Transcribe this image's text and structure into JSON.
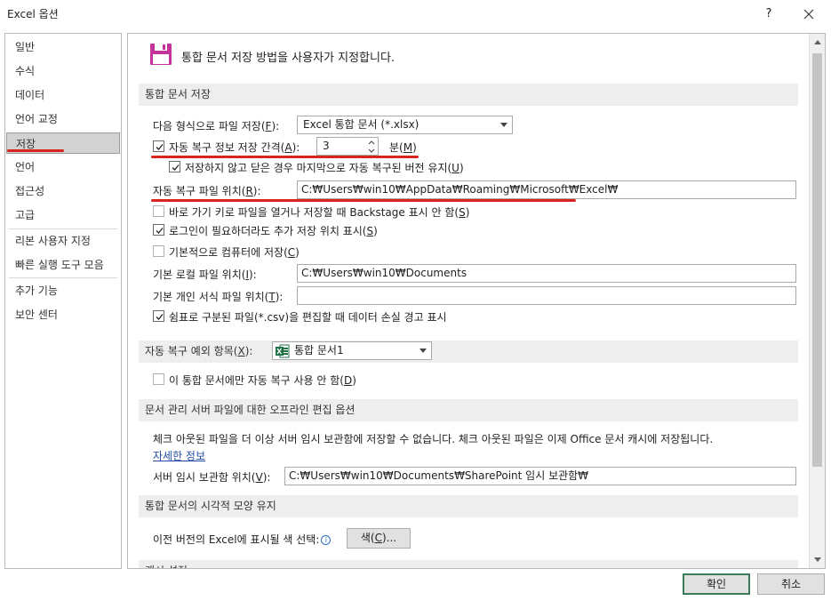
{
  "window": {
    "title": "Excel 옵션",
    "help": "?"
  },
  "sidebar": {
    "items": [
      {
        "label": "일반"
      },
      {
        "label": "수식"
      },
      {
        "label": "데이터"
      },
      {
        "label": "언어 교정"
      },
      {
        "label": "저장",
        "selected": true
      },
      {
        "label": "언어"
      },
      {
        "label": "접근성"
      },
      {
        "label": "고급"
      },
      {
        "label": "리본 사용자 지정"
      },
      {
        "label": "빠른 실행 도구 모음"
      },
      {
        "label": "추가 기능"
      },
      {
        "label": "보안 센터"
      }
    ]
  },
  "header": {
    "text": "통합 문서 저장 방법을 사용자가 지정합니다."
  },
  "save_section": {
    "title": "통합 문서 저장",
    "format_label": "다음 형식으로 파일 저장(",
    "format_key": "F",
    "format_suffix": "):",
    "format_value": "Excel 통합 문서 (*.xlsx)",
    "autorecover_label": "자동 복구 정보 저장 간격(",
    "autorecover_key": "A",
    "autorecover_suffix": "):",
    "autorecover_checked": true,
    "interval_value": "3",
    "minutes_label": "분(",
    "minutes_key": "M",
    "minutes_suffix": ")",
    "keep_version_label": "저장하지 않고 닫은 경우 마지막으로 자동 복구된 버전 유지(",
    "keep_version_key": "U",
    "keep_version_suffix": ")",
    "keep_version_checked": true,
    "autorecover_location_label": "자동 복구 파일 위치(",
    "autorecover_location_key": "R",
    "autorecover_location_suffix": "):",
    "autorecover_location_value": "C:₩Users₩win10₩AppData₩Roaming₩Microsoft₩Excel₩",
    "no_backstage_label": "바로 가기 키로 파일을 열거나 저장할 때 Backstage 표시 안 함(",
    "no_backstage_key": "S",
    "no_backstage_suffix": ")",
    "no_backstage_checked": false,
    "show_locations_label": "로그인이 필요하더라도 추가 저장 위치 표시(",
    "show_locations_key": "S",
    "show_locations_suffix": ")",
    "show_locations_checked": true,
    "save_computer_label": "기본적으로 컴퓨터에 저장(",
    "save_computer_key": "C",
    "save_computer_suffix": ")",
    "save_computer_checked": false,
    "local_location_label": "기본 로컬 파일 위치(",
    "local_location_key": "I",
    "local_location_suffix": "):",
    "local_location_value": "C:₩Users₩win10₩Documents",
    "personal_templates_label": "기본 개인 서식 파일 위치(",
    "personal_templates_key": "T",
    "personal_templates_suffix": "):",
    "personal_templates_value": "",
    "csv_warning_label": "쉼표로 구분된 파일(*.csv)을 편집할 때 데이터 손실 경고 표시",
    "csv_warning_checked": true
  },
  "autorecover_exceptions": {
    "label": "자동 복구 예외 항목(",
    "key": "X",
    "suffix": "):",
    "workbook_value": "통합 문서1",
    "disable_label": "이 통합 문서에만 자동 복구 사용 안 함(",
    "disable_key": "D",
    "disable_suffix": ")",
    "disable_checked": false
  },
  "offline_editing": {
    "title": "문서 관리 서버 파일에 대한 오프라인 편집 옵션",
    "description": "체크 아웃된 파일을 더 이상 서버 임시 보관함에 저장할 수 없습니다. 체크 아웃된 파일은 이제 Office 문서 캐시에 저장됩니다.",
    "details_link": "자세한 정보",
    "drafts_label": "서버 임시 보관함 위치(",
    "drafts_key": "V",
    "drafts_suffix": "):",
    "drafts_value": "C:₩Users₩win10₩Documents₩SharePoint 임시 보관함₩"
  },
  "visual_appearance": {
    "title": "통합 문서의 시각적 모양 유지",
    "colors_label": "이전 버전의 Excel에 표시될 색 선택:",
    "colors_button_label": "색(",
    "colors_button_key": "C",
    "colors_button_suffix": ")..."
  },
  "cut_section": {
    "title": "캐시 설정"
  },
  "footer": {
    "ok": "확인",
    "cancel": "취소"
  },
  "colors": {
    "annotation_red": "#d9231f",
    "excel_green": "#1e7145",
    "save_icon": "#c2349b",
    "selected_nav": "#d2d2d2"
  }
}
